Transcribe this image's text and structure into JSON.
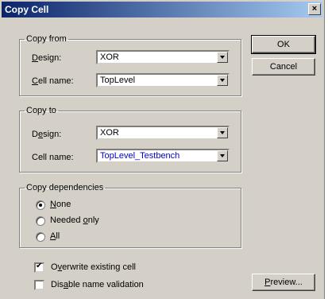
{
  "window": {
    "title": "Copy Cell",
    "close_glyph": "×"
  },
  "copy_from": {
    "legend": "Copy from",
    "design_label_u": "D",
    "design_label_rest": "esign:",
    "design_value": "XOR",
    "cell_label_u": "C",
    "cell_label_rest": "ell name:",
    "cell_value": "TopLevel"
  },
  "copy_to": {
    "legend": "Copy to",
    "design_label_a": "D",
    "design_label_u": "e",
    "design_label_rest": "sign:",
    "design_value": "XOR",
    "cell_label": "Cell name:",
    "cell_value": "TopLevel_Testbench",
    "cell_value_color": "#0000cc"
  },
  "dependencies": {
    "legend": "Copy dependencies",
    "opt_none_u": "N",
    "opt_none_rest": "one",
    "opt_needed_a": "Needed ",
    "opt_needed_u": "o",
    "opt_needed_rest": "nly",
    "opt_all_u": "A",
    "opt_all_rest": "ll",
    "selected": "None"
  },
  "overwrite": {
    "label_a": "O",
    "label_u": "v",
    "label_rest": "erwrite existing cell",
    "checked": true
  },
  "disable": {
    "label_a": "Dis",
    "label_u": "a",
    "label_rest": "ble name validation",
    "checked": false
  },
  "buttons": {
    "ok": "OK",
    "cancel": "Cancel",
    "preview_u": "P",
    "preview_rest": "review..."
  }
}
